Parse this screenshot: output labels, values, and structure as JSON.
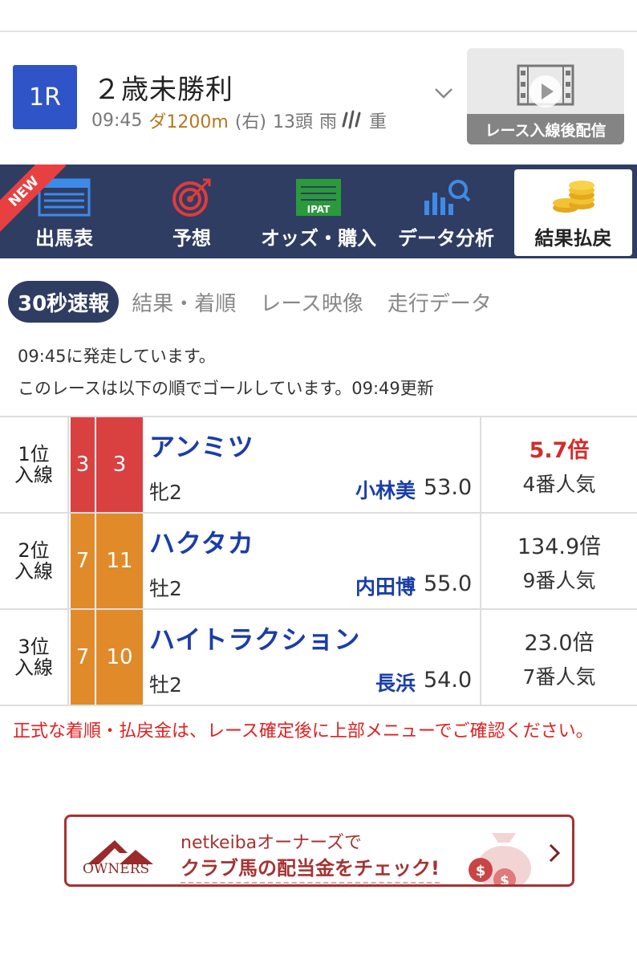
{
  "race": {
    "number": "1R",
    "name": "２歳未勝利",
    "time": "09:45",
    "track": "ダ1200m",
    "direction": "(右)",
    "heads": "13頭",
    "weather": "雨",
    "condition": "重",
    "video_caption": "レース入線後配信"
  },
  "nav": {
    "items": [
      {
        "label": "出馬表",
        "icon": "entry-table-icon",
        "badge": "NEW"
      },
      {
        "label": "予想",
        "icon": "target-icon"
      },
      {
        "label": "オッズ・購入",
        "icon": "ipat-icon",
        "icon_text": "IPAT"
      },
      {
        "label": "データ分析",
        "icon": "data-chart-icon"
      },
      {
        "label": "結果払戻",
        "icon": "coins-icon",
        "active": true
      }
    ]
  },
  "tabs": [
    {
      "label": "30秒速報",
      "active": true
    },
    {
      "label": "結果・着順"
    },
    {
      "label": "レース映像"
    },
    {
      "label": "走行データ"
    }
  ],
  "info": {
    "line1": "09:45に発走しています。",
    "line2": "このレースは以下の順でゴールしています。09:49更新"
  },
  "results": [
    {
      "rank": "1位",
      "rank_sub": "入線",
      "waku": "3",
      "umaban": "3",
      "name": "アンミツ",
      "sex_age": "牝2",
      "jockey": "小林美",
      "weight": "53.0",
      "odds": "5.7倍",
      "popularity": "4番人気",
      "color": "#d94040",
      "hot": true
    },
    {
      "rank": "2位",
      "rank_sub": "入線",
      "waku": "7",
      "umaban": "11",
      "name": "ハクタカ",
      "sex_age": "牡2",
      "jockey": "内田博",
      "weight": "55.0",
      "odds": "134.9倍",
      "popularity": "9番人気",
      "color": "#e08a2a",
      "hot": false
    },
    {
      "rank": "3位",
      "rank_sub": "入線",
      "waku": "7",
      "umaban": "10",
      "name": "ハイトラクション",
      "sex_age": "牡2",
      "jockey": "長浜",
      "weight": "54.0",
      "odds": "23.0倍",
      "popularity": "7番人気",
      "color": "#e08a2a",
      "hot": false
    }
  ],
  "notice": "正式な着順・払戻金は、レース確定後に上部メニューでご確認ください。",
  "banner": {
    "logo_text": "OWNERS",
    "line1": "netkeibaオーナーズで",
    "line2": "クラブ馬の配当金をチェック!"
  }
}
